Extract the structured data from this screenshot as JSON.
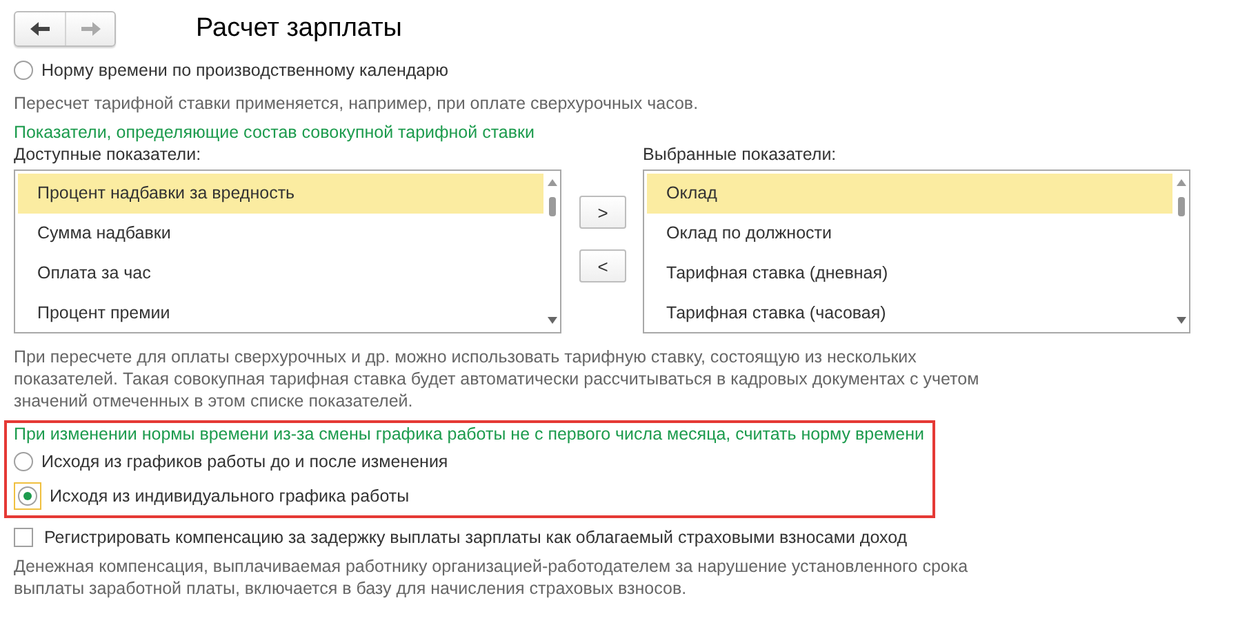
{
  "window": {
    "title": "Расчет зарплаты"
  },
  "norm_option": {
    "label": "Норму времени по производственному календарю",
    "selected": false
  },
  "recalc_note": "Пересчет тарифной ставки применяется, например, при оплате сверхурочных часов.",
  "indicators": {
    "heading": "Показатели, определяющие состав совокупной тарифной ставки",
    "available": {
      "label": "Доступные показатели:",
      "items": [
        {
          "label": "Процент надбавки за вредность",
          "selected": true
        },
        {
          "label": "Сумма надбавки",
          "selected": false
        },
        {
          "label": "Оплата за час",
          "selected": false
        },
        {
          "label": "Процент премии",
          "selected": false
        }
      ]
    },
    "move_buttons": [
      ">",
      "<"
    ],
    "chosen": {
      "label": "Выбранные показатели:",
      "items": [
        {
          "label": "Оклад",
          "selected": true
        },
        {
          "label": "Оклад по должности",
          "selected": false
        },
        {
          "label": "Тарифная ставка (дневная)",
          "selected": false
        },
        {
          "label": "Тарифная ставка (часовая)",
          "selected": false
        }
      ]
    },
    "note": "При пересчете для оплаты сверхурочных и др. можно использовать тарифную ставку, состоящую из нескольких показателей. Такая совокупная тарифная ставка будет автоматически рассчитываться в кадровых документах с учетом значений отмеченных в этом списке показателей."
  },
  "schedule_change": {
    "heading": "При изменении нормы времени из-за смены графика работы не с первого числа месяца, считать норму времени",
    "options": [
      {
        "label": "Исходя из графиков работы до и после изменения",
        "selected": false
      },
      {
        "label": "Исходя из индивидуального графика работы",
        "selected": true
      }
    ]
  },
  "compensation": {
    "label": "Регистрировать компенсацию за задержку выплаты зарплаты как облагаемый страховыми взносами доход",
    "checked": false,
    "note": "Денежная компенсация, выплачиваемая работнику организацией-работодателем за нарушение установленного срока выплаты заработной платы, включается в базу для начисления страховых взносов."
  }
}
